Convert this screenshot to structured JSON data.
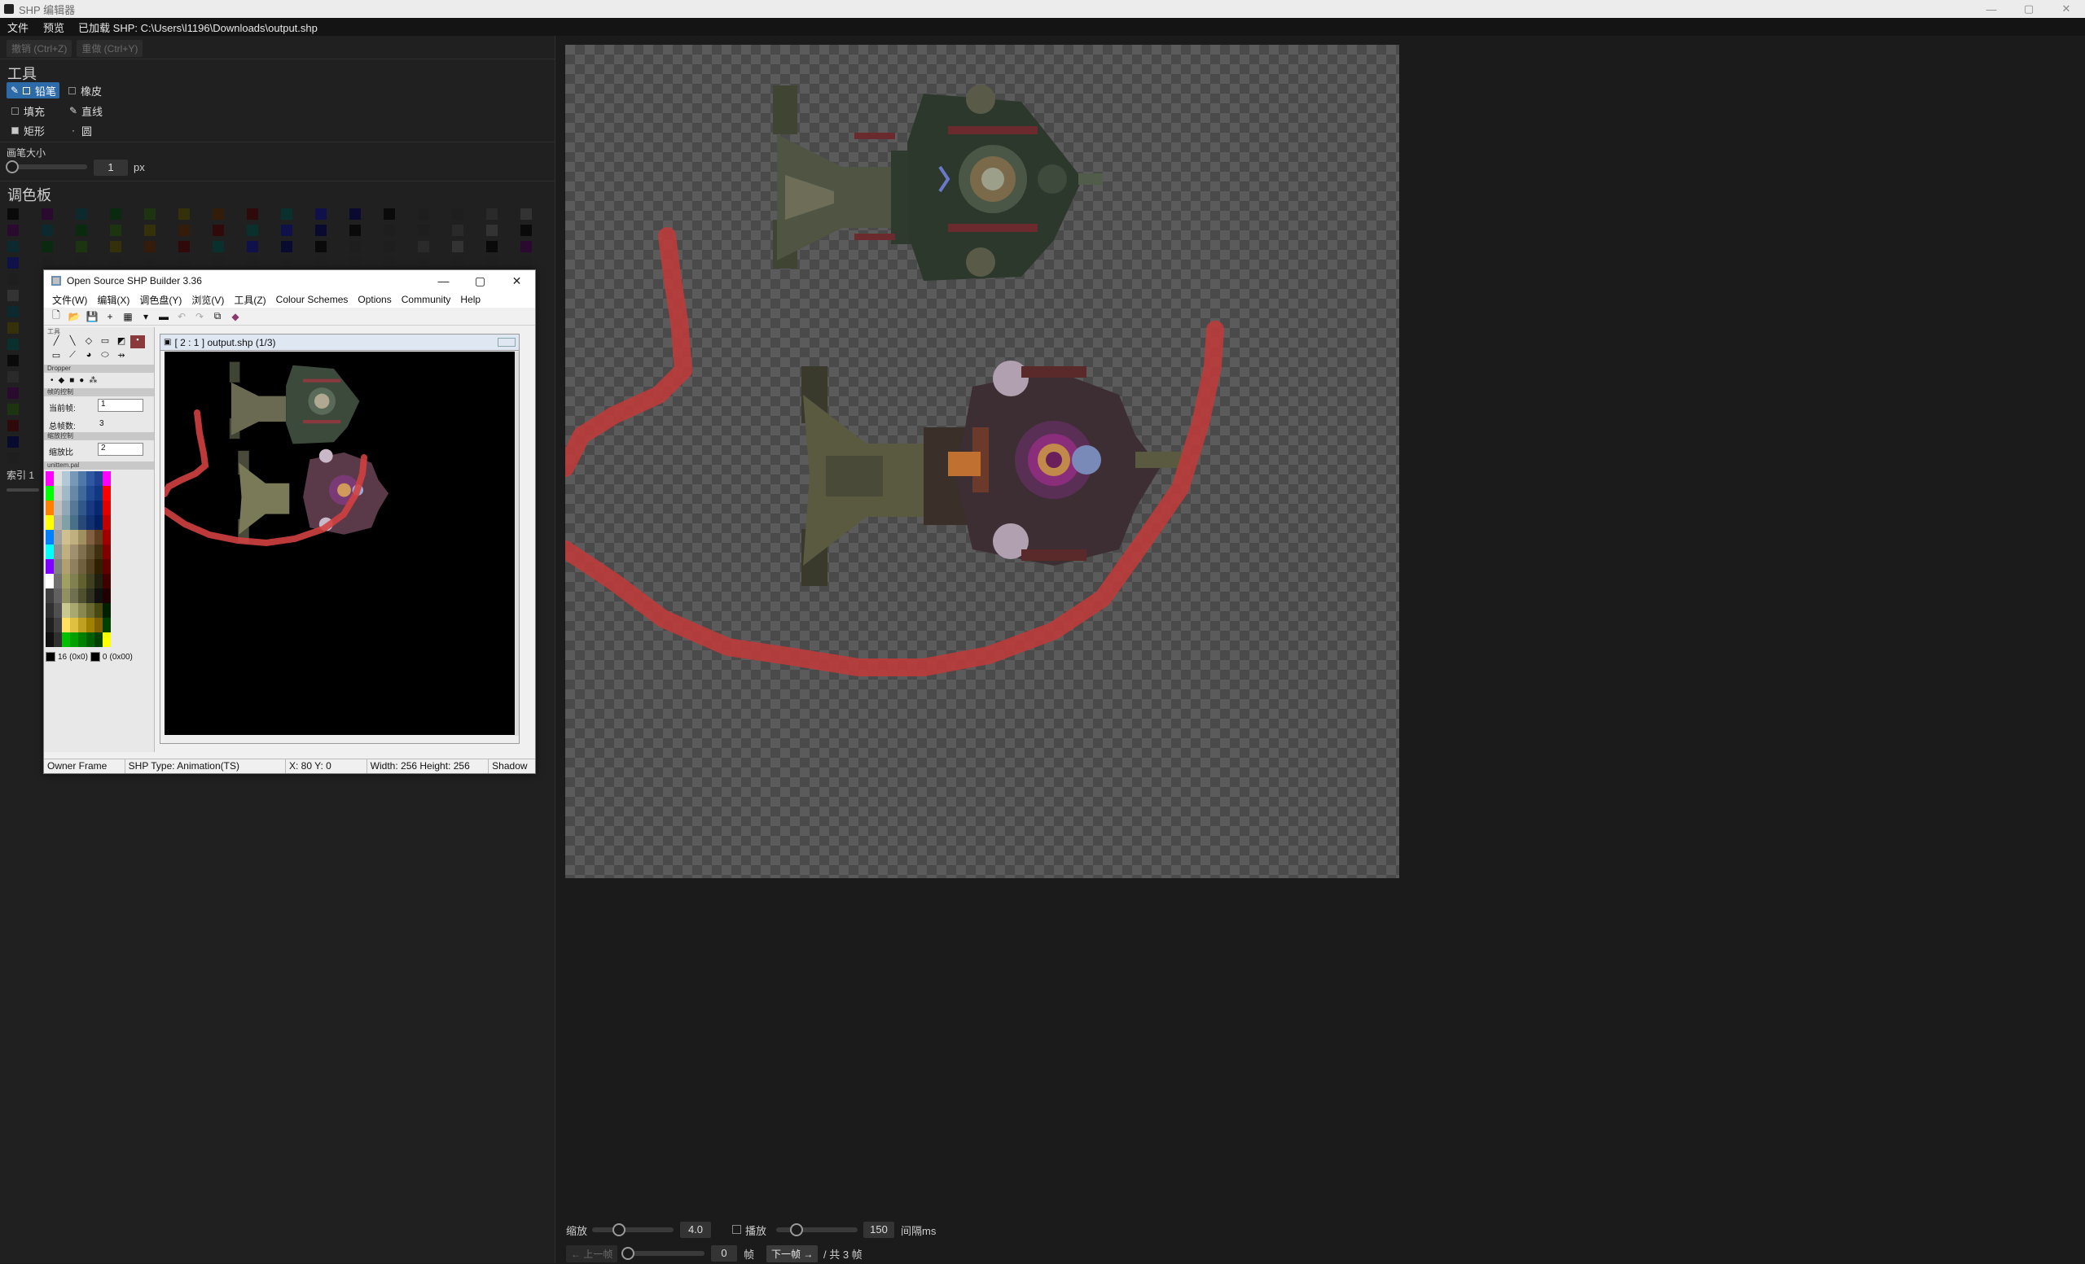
{
  "window": {
    "title": "SHP 编辑器",
    "controls": [
      "—",
      "▢",
      "✕"
    ]
  },
  "menubar": {
    "file": "文件",
    "preview": "预览",
    "loaded": "已加载 SHP: C:\\Users\\l1196\\Downloads\\output.shp"
  },
  "left": {
    "undo": "撤销 (Ctrl+Z)",
    "redo": "重做 (Ctrl+Y)",
    "tools_title": "工具",
    "tools": {
      "pencil": "铅笔",
      "eraser": "橡皮",
      "fill": "填充",
      "line": "直线",
      "rect": "矩形",
      "circle": "圆"
    },
    "brush_label": "画笔大小",
    "brush_value": "1",
    "brush_unit": "px",
    "palette_title": "调色板",
    "index_label": "索引 1"
  },
  "shpbuilder": {
    "title": "Open Source SHP Builder 3.36",
    "menu": [
      "文件(W)",
      "编辑(X)",
      "调色盘(Y)",
      "浏览(V)",
      "工具(Z)",
      "Colour Schemes",
      "Options",
      "Community",
      "Help"
    ],
    "side": {
      "tools_hdr": "工具",
      "dropper": "Dropper",
      "frame_hdr": "帧的控制",
      "current_frame_label": "当前帧:",
      "current_frame": "1",
      "total_frames_label": "总帧数:",
      "total_frames": "3",
      "zoom_hdr": "缩放控制",
      "zoom_label": "缩放比",
      "zoom": "2",
      "palette_hdr": "unittem.pal",
      "col1": "16",
      "col1_hex": "(0x0)",
      "col2": "0",
      "col2_hex": "(0x00)"
    },
    "doc_title": "[ 2 : 1 ] output.shp (1/3)",
    "status": {
      "owner": "Owner Frame",
      "type": "SHP Type: Animation(TS)",
      "xy": "X: 80 Y: 0",
      "size": "Width: 256 Height: 256",
      "shadow": "Shadow"
    }
  },
  "bottom": {
    "zoom_label": "缩放",
    "zoom_value": "4.0",
    "zoom_level": 0.3,
    "play_label": "播放",
    "interval_value": "150",
    "interval_unit": "间隔ms",
    "prev": "← 上一帧",
    "frame_value": "0",
    "frame_unit": "帧",
    "next": "下一帧 →",
    "total": "/ 共 3 帧"
  },
  "colors": {
    "accent": "#2d6aa8",
    "stroke_red": "#c23a3a"
  }
}
